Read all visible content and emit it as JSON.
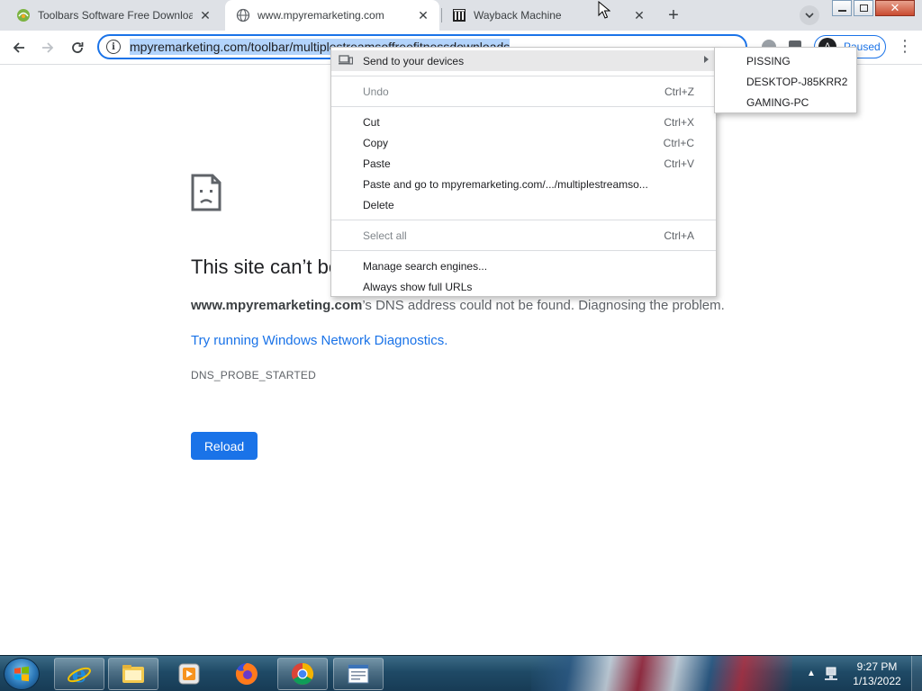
{
  "tabs": [
    {
      "title": "Toolbars Software Free Downloads",
      "favicon": "toolbars-site-icon"
    },
    {
      "title": "www.mpyremarketing.com",
      "favicon": "globe-icon",
      "active": true
    },
    {
      "title": "Wayback Machine",
      "favicon": "wayback-icon"
    }
  ],
  "toolbar": {
    "url_text": "mpyremarketing.com/toolbar/multiplestreamsoffreefitnessdownloads",
    "profile_avatar": "A",
    "profile_label": "Paused"
  },
  "error_page": {
    "title": "This site can’t be reached",
    "domain": "www.mpyremarketing.com",
    "description": "’s DNS address could not be found. Diagnosing the problem.",
    "link": "Try running Windows Network Diagnostics.",
    "code": "DNS_PROBE_STARTED",
    "reload_label": "Reload"
  },
  "context_menu": {
    "send_to_devices": "Send to your devices",
    "undo": {
      "label": "Undo",
      "shortcut": "Ctrl+Z"
    },
    "cut": {
      "label": "Cut",
      "shortcut": "Ctrl+X"
    },
    "copy": {
      "label": "Copy",
      "shortcut": "Ctrl+C"
    },
    "paste": {
      "label": "Paste",
      "shortcut": "Ctrl+V"
    },
    "paste_and_go": "Paste and go to mpyremarketing.com/.../multiplestreamso...",
    "delete": "Delete",
    "select_all": {
      "label": "Select all",
      "shortcut": "Ctrl+A"
    },
    "manage_search": "Manage search engines...",
    "show_full_urls": "Always show full URLs"
  },
  "devices": [
    "PISSING",
    "DESKTOP-J85KRR2",
    "GAMING-PC"
  ],
  "taskbar": {
    "time": "9:27 PM",
    "date": "1/13/2022",
    "apps": [
      "internet-explorer-icon",
      "file-explorer-icon",
      "media-player-icon",
      "firefox-icon",
      "chrome-icon",
      "notepad-icon"
    ]
  },
  "colors": {
    "accent": "#1a73e8",
    "tabstrip": "#dee1e6"
  }
}
